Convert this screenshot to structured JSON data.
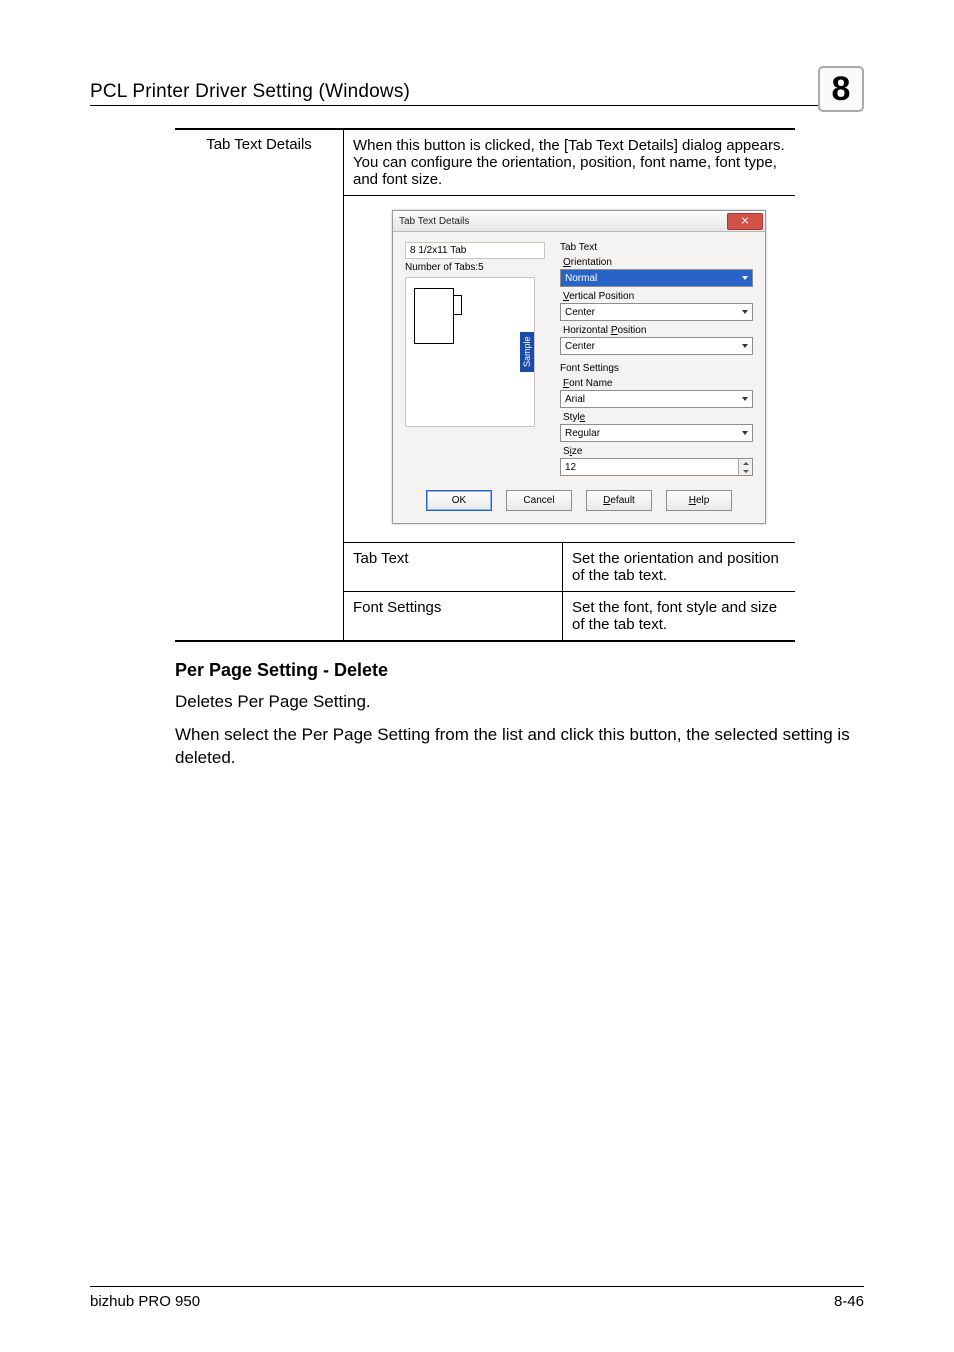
{
  "header": {
    "title": "PCL Printer Driver Setting (Windows)",
    "chapter_number": "8"
  },
  "table": {
    "row_label": "Tab Text Details",
    "description": "When this button is clicked, the [Tab Text Details] dialog appears. You can configure the orientation, position, font name, font type, and font size.",
    "sub": [
      {
        "label": "Tab Text",
        "desc": "Set the orientation and position of the tab text."
      },
      {
        "label": "Font Settings",
        "desc": "Set the font, font style and size of the tab text."
      }
    ]
  },
  "dialog": {
    "title": "Tab Text Details",
    "left": {
      "paper": "8 1/2x11 Tab",
      "tabs": "Number of Tabs:5",
      "sample_label": "Sample"
    },
    "grp_tab_text": "Tab Text",
    "orientation": {
      "label": "Orientation",
      "underline": "O",
      "value": "Normal"
    },
    "vpos": {
      "label": "Vertical Position",
      "underline": "V",
      "value": "Center"
    },
    "hpos": {
      "label": "Horizontal Position",
      "underline": "P",
      "value": "Center"
    },
    "grp_font": "Font Settings",
    "fontname": {
      "label": "Font Name",
      "underline": "F",
      "value": "Arial"
    },
    "style": {
      "label": "Style",
      "underline": "e",
      "value": "Regular"
    },
    "size": {
      "label": "Size",
      "underline": "i",
      "value": "12"
    },
    "buttons": {
      "ok": "OK",
      "cancel": "Cancel",
      "default": "Default",
      "default_u": "D",
      "help": "Help",
      "help_u": "H"
    }
  },
  "section": {
    "heading": "Per Page Setting - Delete",
    "p1": "Deletes Per Page Setting.",
    "p2": "When select the Per Page Setting from the list and click this button, the selected setting is deleted."
  },
  "footer": {
    "product": "bizhub PRO 950",
    "page": "8-46"
  }
}
